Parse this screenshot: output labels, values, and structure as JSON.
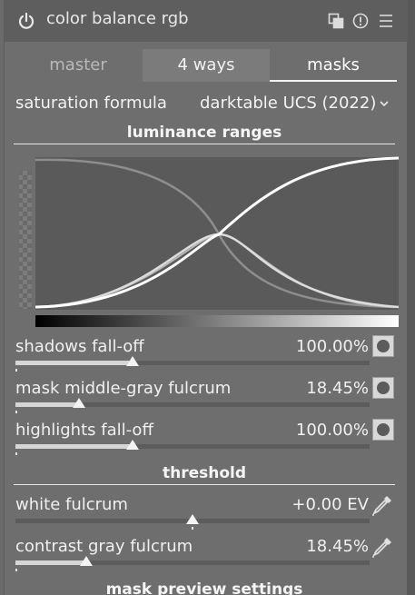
{
  "header": {
    "title": "color balance rgb",
    "icons": [
      "power-icon",
      "presets-icon",
      "reset-icon",
      "menu-icon"
    ]
  },
  "tabs": [
    {
      "label": "master",
      "active": false
    },
    {
      "label": "4 ways",
      "active": false
    },
    {
      "label": "masks",
      "active": true
    }
  ],
  "saturation": {
    "label": "saturation formula",
    "value": "darktable UCS (2022)"
  },
  "sections": {
    "luminance": "luminance ranges",
    "threshold": "threshold",
    "preview": "mask preview settings"
  },
  "sliders": {
    "shadows": {
      "label": "shadows fall-off",
      "value": "100.00%",
      "fraction": 0.33
    },
    "middle": {
      "label": "mask middle-gray fulcrum",
      "value": "18.45%",
      "fraction": 0.18
    },
    "highlights": {
      "label": "highlights fall-off",
      "value": "100.00%",
      "fraction": 0.33
    },
    "white": {
      "label": "white fulcrum",
      "value": "+0.00 EV",
      "fraction": 0.5
    },
    "contrast": {
      "label": "contrast gray fulcrum",
      "value": "18.45%",
      "fraction": 0.2
    }
  },
  "colors": {
    "panel": "#6e6e6e",
    "header": "#5e5e5e",
    "graph_bg": "#5a5a5a",
    "curve_bright": "#ffffff",
    "curve_dim": "#8e8e8e"
  }
}
